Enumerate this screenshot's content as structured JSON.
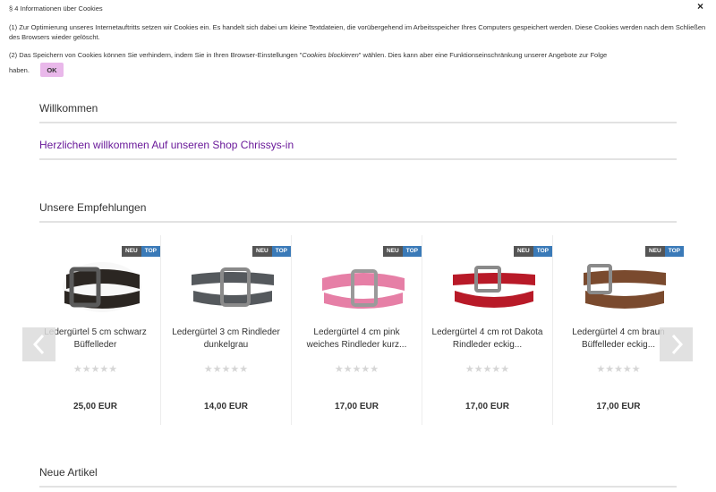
{
  "cookie": {
    "title": "§ 4 Informationen über Cookies",
    "close_symbol": "×",
    "para1": "(1) Zur Optimierung unseres Internetauftritts setzen wir Cookies ein. Es handelt sich dabei um kleine Textdateien, die vorübergehend im Arbeitsspeicher Ihres Computers gespeichert werden. Diese Cookies werden nach dem Schließen des Browsers wieder gelöscht.",
    "para2_a": "(2) Das Speichern von Cookies können Sie verhindern, indem Sie in Ihren Browser-Einstellungen \"",
    "para2_em": "Cookies blockieren",
    "para2_b": "\" wählen. Dies kann aber eine Funktionseinschränkung unserer Angebote zur Folge",
    "para2_end": "haben.",
    "ok_label": "OK"
  },
  "welcome": {
    "heading": "Willkommen",
    "link": "Herzlichen willkommen Auf unseren Shop Chrissys-in"
  },
  "recommendations": {
    "heading": "Unsere Empfehlungen",
    "badge_new": "NEU",
    "badge_top": "TOP",
    "stars": "★★★★★",
    "products": [
      {
        "name": "Ledergürtel 5 cm schwarz Büffelleder",
        "price": "25,00 EUR",
        "color": "#2b2622",
        "buckle": "#5a5a5a",
        "rating": 0
      },
      {
        "name": "Ledergürtel 3 cm Rindleder dunkelgrau",
        "price": "14,00 EUR",
        "color": "#55595d",
        "buckle": "#8a8a8a",
        "rating": 0
      },
      {
        "name": "Ledergürtel 4 cm pink weiches Rindleder kurz...",
        "price": "17,00 EUR",
        "color": "#e67fa6",
        "buckle": "#9a9a9a",
        "rating": 0
      },
      {
        "name": "Ledergürtel 4 cm rot Dakota Rindleder eckig...",
        "price": "17,00 EUR",
        "color": "#b81a28",
        "buckle": "#8a8a8a",
        "rating": 0
      },
      {
        "name": "Ledergürtel 4 cm braun Büffelleder eckig...",
        "price": "17,00 EUR",
        "color": "#7a4a2e",
        "buckle": "#8a8a8a",
        "rating": 0
      }
    ],
    "prev_icon": "chevron-left-icon",
    "next_icon": "chevron-right-icon"
  },
  "new_items": {
    "heading": "Neue Artikel"
  }
}
